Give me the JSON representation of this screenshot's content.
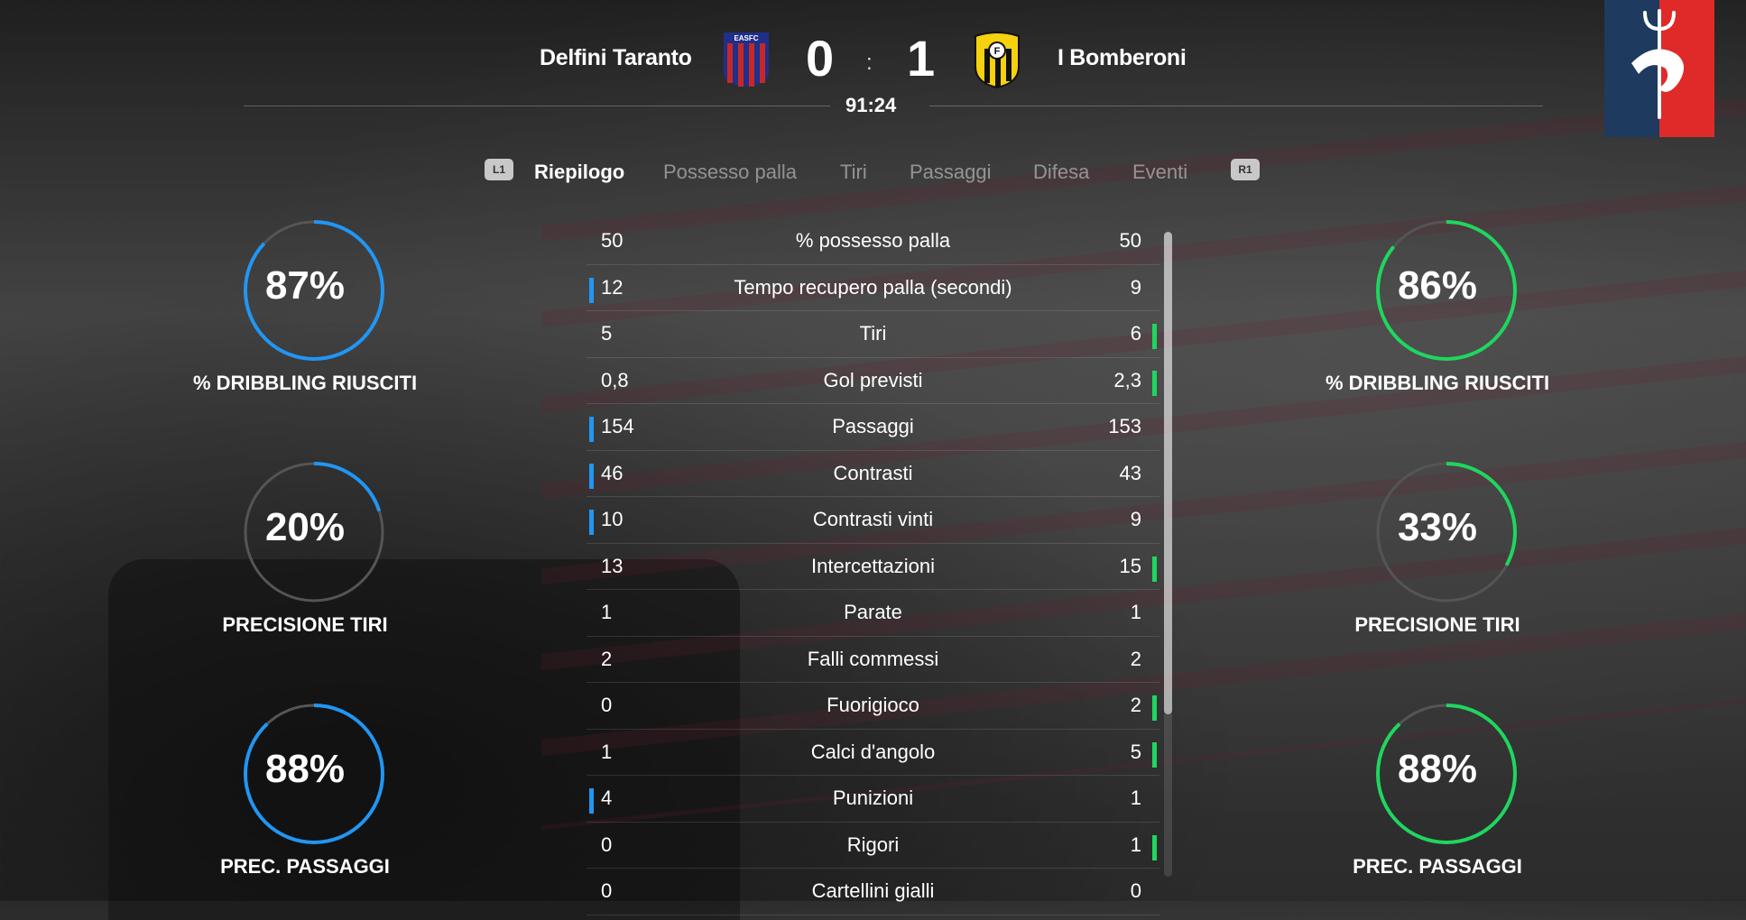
{
  "match": {
    "home_team": "Delfini Taranto",
    "away_team": "I Bomberoni",
    "home_score": "0",
    "away_score": "1",
    "separator": ":",
    "clock": "91:24",
    "home_crest_text": "EASFC",
    "away_crest_text": "F"
  },
  "tabs": {
    "left_shoulder": "L1",
    "right_shoulder": "R1",
    "items": [
      "Riepilogo",
      "Possesso palla",
      "Tiri",
      "Passaggi",
      "Difesa",
      "Eventi"
    ],
    "active": "Riepilogo"
  },
  "home_gauges": [
    {
      "value": "87%",
      "fraction": 0.87,
      "label": "% DRIBBLING RIUSCITI"
    },
    {
      "value": "20%",
      "fraction": 0.2,
      "label": "PRECISIONE TIRI"
    },
    {
      "value": "88%",
      "fraction": 0.88,
      "label": "PREC. PASSAGGI"
    }
  ],
  "away_gauges": [
    {
      "value": "86%",
      "fraction": 0.86,
      "label": "% DRIBBLING RIUSCITI"
    },
    {
      "value": "33%",
      "fraction": 0.33,
      "label": "PRECISIONE TIRI"
    },
    {
      "value": "88%",
      "fraction": 0.88,
      "label": "PREC. PASSAGGI"
    }
  ],
  "stats": [
    {
      "label": "% possesso palla",
      "home": "50",
      "away": "50",
      "lead": "none"
    },
    {
      "label": "Tempo recupero palla (secondi)",
      "home": "12",
      "away": "9",
      "lead": "home"
    },
    {
      "label": "Tiri",
      "home": "5",
      "away": "6",
      "lead": "away"
    },
    {
      "label": "Gol previsti",
      "home": "0,8",
      "away": "2,3",
      "lead": "away"
    },
    {
      "label": "Passaggi",
      "home": "154",
      "away": "153",
      "lead": "home"
    },
    {
      "label": "Contrasti",
      "home": "46",
      "away": "43",
      "lead": "home"
    },
    {
      "label": "Contrasti vinti",
      "home": "10",
      "away": "9",
      "lead": "home"
    },
    {
      "label": "Intercettazioni",
      "home": "13",
      "away": "15",
      "lead": "away"
    },
    {
      "label": "Parate",
      "home": "1",
      "away": "1",
      "lead": "none"
    },
    {
      "label": "Falli commessi",
      "home": "2",
      "away": "2",
      "lead": "none"
    },
    {
      "label": "Fuorigioco",
      "home": "0",
      "away": "2",
      "lead": "away"
    },
    {
      "label": "Calci d'angolo",
      "home": "1",
      "away": "5",
      "lead": "away"
    },
    {
      "label": "Punizioni",
      "home": "4",
      "away": "1",
      "lead": "home"
    },
    {
      "label": "Rigori",
      "home": "0",
      "away": "1",
      "lead": "away"
    },
    {
      "label": "Cartellini gialli",
      "home": "0",
      "away": "0",
      "lead": "none"
    }
  ],
  "colors": {
    "home_accent": "#2196f3",
    "away_accent": "#1fd65f",
    "ring_track": "#555555"
  },
  "icons": {
    "club_badge": "trident-dolphin-badge-icon",
    "home_crest": "easfc-crest-icon",
    "away_crest": "bomberoni-crest-icon"
  }
}
